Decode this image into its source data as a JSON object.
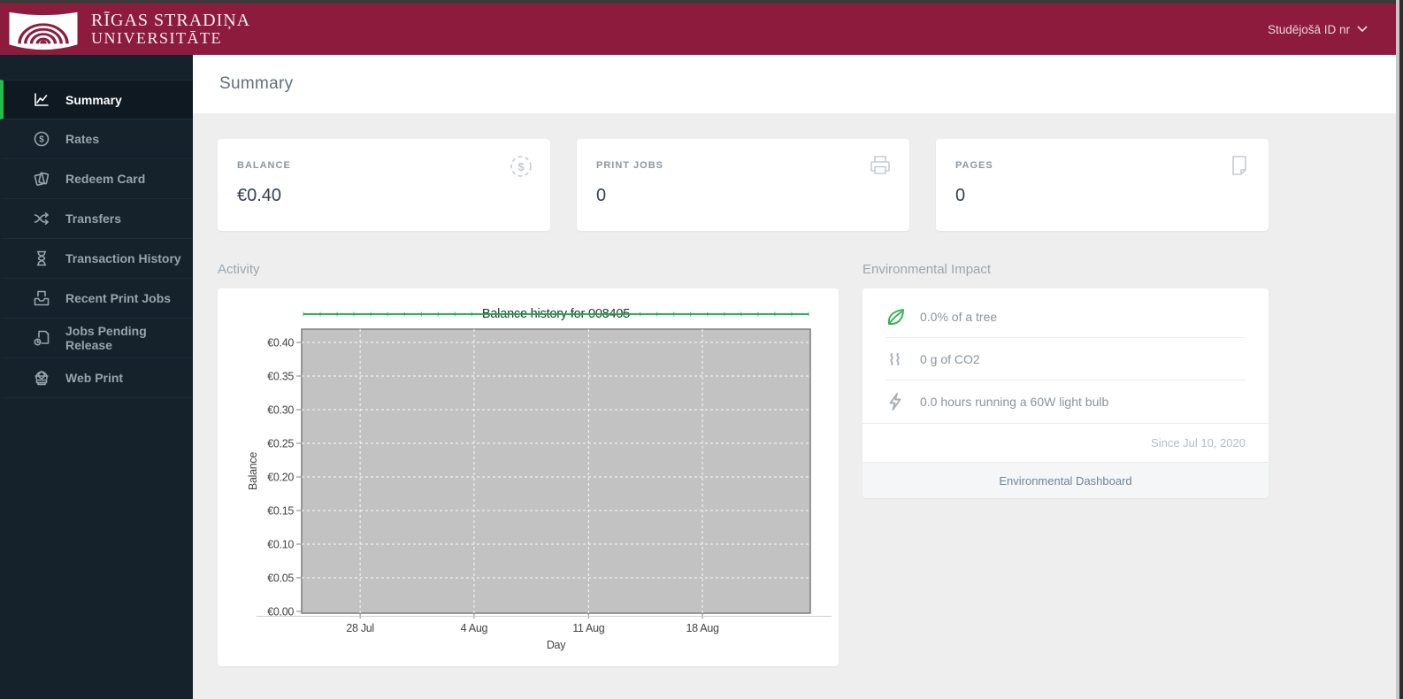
{
  "header": {
    "logo_line1": "RĪGAS STRADIŅA",
    "logo_line2": "UNIVERSITĀTE",
    "account_label": "Studējošā ID nr"
  },
  "sidebar": {
    "items": [
      {
        "label": "Summary",
        "icon": "summary-icon",
        "active": true
      },
      {
        "label": "Rates",
        "icon": "rates-icon",
        "active": false
      },
      {
        "label": "Redeem Card",
        "icon": "redeem-card-icon",
        "active": false
      },
      {
        "label": "Transfers",
        "icon": "transfers-icon",
        "active": false
      },
      {
        "label": "Transaction History",
        "icon": "transaction-history-icon",
        "active": false
      },
      {
        "label": "Recent Print Jobs",
        "icon": "recent-print-jobs-icon",
        "active": false
      },
      {
        "label": "Jobs Pending Release",
        "icon": "jobs-pending-release-icon",
        "active": false
      },
      {
        "label": "Web Print",
        "icon": "web-print-icon",
        "active": false
      }
    ]
  },
  "page": {
    "title": "Summary"
  },
  "stats": {
    "cards": [
      {
        "label": "BALANCE",
        "value": "€0.40",
        "icon": "balance-icon"
      },
      {
        "label": "PRINT JOBS",
        "value": "0",
        "icon": "printer-icon"
      },
      {
        "label": "PAGES",
        "value": "0",
        "icon": "page-icon"
      }
    ]
  },
  "activity": {
    "heading": "Activity"
  },
  "chart_data": {
    "type": "line",
    "title": "Balance history for 008405",
    "xlabel": "Day",
    "ylabel": "Balance",
    "x_ticks": [
      "28 Jul",
      "4 Aug",
      "11 Aug",
      "18 Aug"
    ],
    "x_tick_fracs": [
      0.115,
      0.339,
      0.564,
      0.788
    ],
    "y_ticks": [
      "€0.00",
      "€0.05",
      "€0.10",
      "€0.15",
      "€0.20",
      "€0.25",
      "€0.30",
      "€0.35",
      "€0.40"
    ],
    "ylim": [
      0,
      0.42
    ],
    "series": [
      {
        "name": "Balance",
        "constant_value": 0.4,
        "points": 31
      }
    ],
    "line_color": "#0ca84e",
    "plot_bg": "#c2c2c2",
    "plot_border": "#7e7e7e",
    "grid": "white-dashed",
    "legend": "none"
  },
  "environment": {
    "heading": "Environmental Impact",
    "rows": [
      {
        "icon": "leaf-icon",
        "text": "0.0% of a tree"
      },
      {
        "icon": "co2-icon",
        "text": "0 g of CO2"
      },
      {
        "icon": "lightning-icon",
        "text": "0.0 hours running a 60W light bulb"
      }
    ],
    "since": "Since Jul 10, 2020",
    "dashboard_link": "Environmental Dashboard"
  },
  "colors": {
    "header_bg": "#8d1b3d",
    "sidebar_bg": "#15222c",
    "sidebar_active_accent": "#1fbf4e",
    "content_bg": "#eeeeef",
    "line_green": "#0ca84e",
    "plot_gray": "#c2c2c2"
  }
}
